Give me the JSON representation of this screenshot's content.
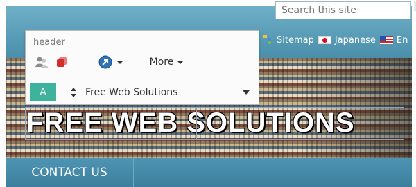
{
  "search": {
    "placeholder": "Search this site"
  },
  "nav": {
    "sitemap": "Sitemap",
    "japanese": "Japanese",
    "english": "En"
  },
  "hero": {
    "title": "FREE WEB SOLUTIONS"
  },
  "bottom_nav": {
    "contact": "CONTACT US"
  },
  "editor": {
    "title": "header",
    "more_label": "More",
    "style_badge": "A",
    "style_value": "Free Web Solutions"
  },
  "colors": {
    "header_blue": "#4a8eab",
    "accent_teal": "#3db39e"
  }
}
